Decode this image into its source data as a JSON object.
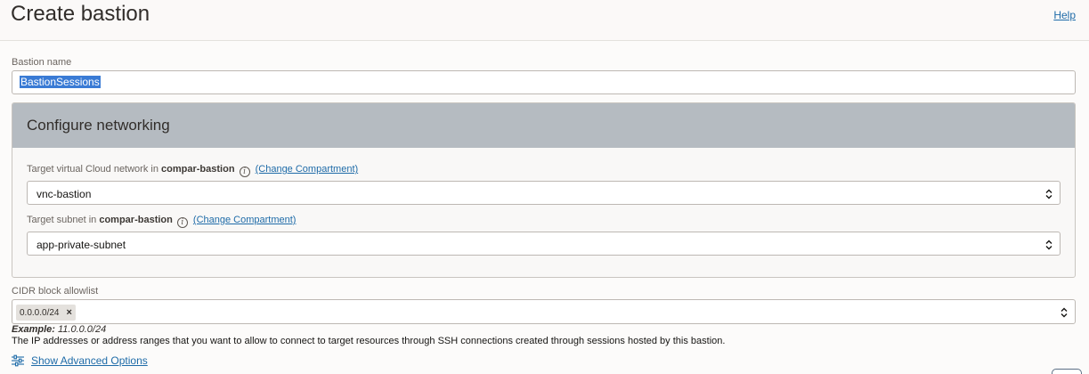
{
  "header": {
    "title": "Create bastion",
    "help_link": "Help"
  },
  "bastion_name": {
    "label": "Bastion name",
    "value": "BastionSessions"
  },
  "networking": {
    "title": "Configure networking",
    "vcn": {
      "label_prefix": "Target virtual Cloud network in",
      "compartment": "compar-bastion",
      "change_link": "(Change Compartment)",
      "value": "vnc-bastion"
    },
    "subnet": {
      "label_prefix": "Target subnet in",
      "compartment": "compar-bastion",
      "change_link": "(Change Compartment)",
      "value": "app-private-subnet"
    }
  },
  "cidr": {
    "label": "CIDR block allowlist",
    "chips": [
      "0.0.0.0/24"
    ],
    "example_label": "Example:",
    "example_value": "11.0.0.0/24",
    "help_text": "The IP addresses or address ranges that you want to allow to connect to target resources through SSH connections created through sessions hosted by this bastion."
  },
  "advanced": {
    "label": "Show Advanced Options",
    "icon": "sliders-icon"
  },
  "colors": {
    "accent": "#1e6ba8",
    "panel_header": "#b5bbc1",
    "selection": "#3a7bd5"
  }
}
